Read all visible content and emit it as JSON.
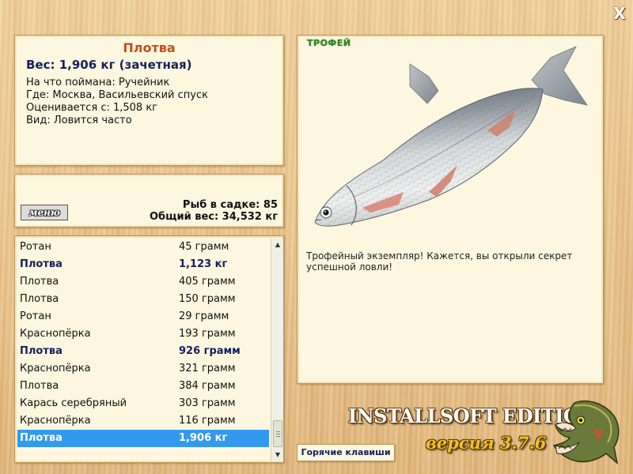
{
  "close_label": "X",
  "info": {
    "fish_name": "Плотва",
    "weight": "Вес: 1,906 кг (зачетная)",
    "lines": [
      "На что поймана: Ручейник",
      "Где: Москва, Васильевский спуск",
      "Оценивается с: 1,508 кг",
      "Вид: Ловится часто"
    ]
  },
  "stats": {
    "menu_label": "меню",
    "fish_count": "Рыб в садке: 85",
    "total_weight": "Общий вес: 34,532 кг"
  },
  "catch_list": [
    {
      "name": "Ротан",
      "weight": "45 грамм",
      "state": "normal"
    },
    {
      "name": "Плотва",
      "weight": "1,123 кг",
      "state": "trophy"
    },
    {
      "name": "Плотва",
      "weight": "405 грамм",
      "state": "normal"
    },
    {
      "name": "Плотва",
      "weight": "150 грамм",
      "state": "normal"
    },
    {
      "name": "Ротан",
      "weight": "29 грамм",
      "state": "normal"
    },
    {
      "name": "Краснопёрка",
      "weight": "193 грамм",
      "state": "normal"
    },
    {
      "name": "Плотва",
      "weight": "926 грамм",
      "state": "trophy"
    },
    {
      "name": "Краснопёрка",
      "weight": "321 грамм",
      "state": "normal"
    },
    {
      "name": "Плотва",
      "weight": "384 грамм",
      "state": "normal"
    },
    {
      "name": "Карась серебряный",
      "weight": "303 грамм",
      "state": "normal"
    },
    {
      "name": "Краснопёрка",
      "weight": "116 грамм",
      "state": "normal"
    },
    {
      "name": "Плотва",
      "weight": "1,906 кг",
      "state": "selected"
    }
  ],
  "trophy": {
    "label": "ТРОФЕЙ",
    "text": "Трофейный экземпляр! Кажется, вы открыли секрет успешной ловли!"
  },
  "branding": {
    "edition": "INSTALLSOFT EDITION",
    "version": "версия 3.7.6"
  },
  "hotkeys_label": "Горячие клавиши",
  "colors": {
    "title": "#c2501a",
    "trophy_entry": "#14205e",
    "selected_row": "#3399ee",
    "trophy_label": "#2f8a26"
  }
}
